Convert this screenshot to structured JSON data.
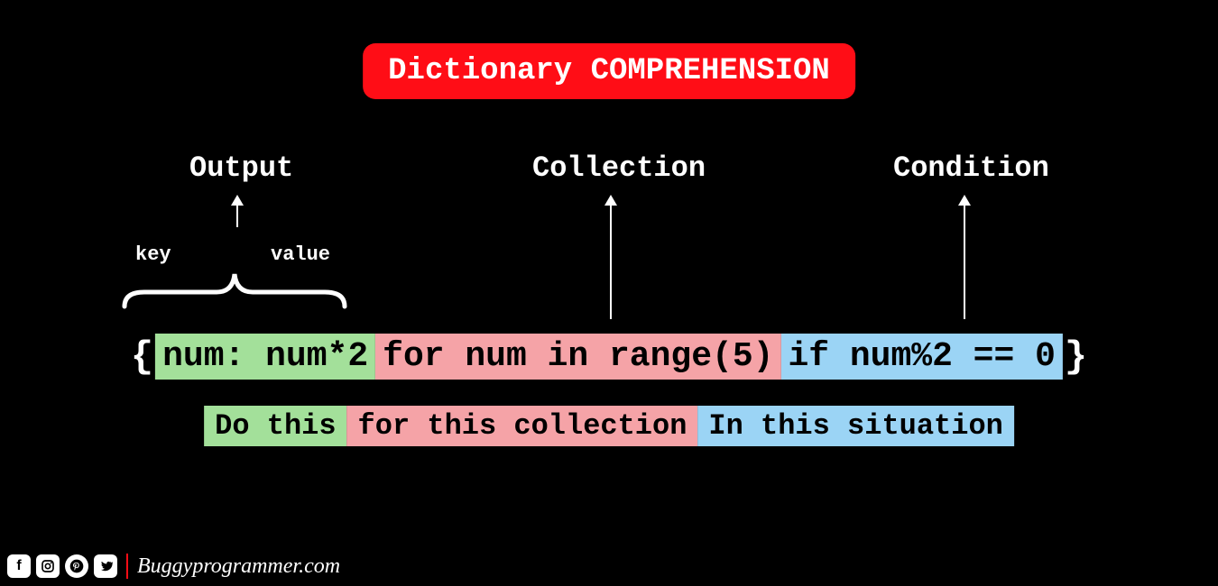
{
  "title": "Dictionary COMPREHENSION",
  "labels": {
    "output": "Output",
    "collection": "Collection",
    "condition": "Condition",
    "key": "key",
    "value": "value"
  },
  "code": {
    "open_brace": "{",
    "close_brace": "}",
    "output_segment": "num: num*2",
    "collection_segment": " for num in range(5)",
    "condition_segment": " if num%2 == 0"
  },
  "captions": {
    "output": "Do this",
    "collection": " for this collection",
    "condition": "In this situation"
  },
  "colors": {
    "background": "#000000",
    "title_bg": "#ff0d16",
    "output_bg": "#a3e09a",
    "collection_bg": "#f5a3a7",
    "condition_bg": "#9bd4f5"
  },
  "footer": {
    "site": "Buggyprogrammer.com",
    "socials": [
      "facebook",
      "instagram",
      "pinterest",
      "twitter"
    ]
  }
}
